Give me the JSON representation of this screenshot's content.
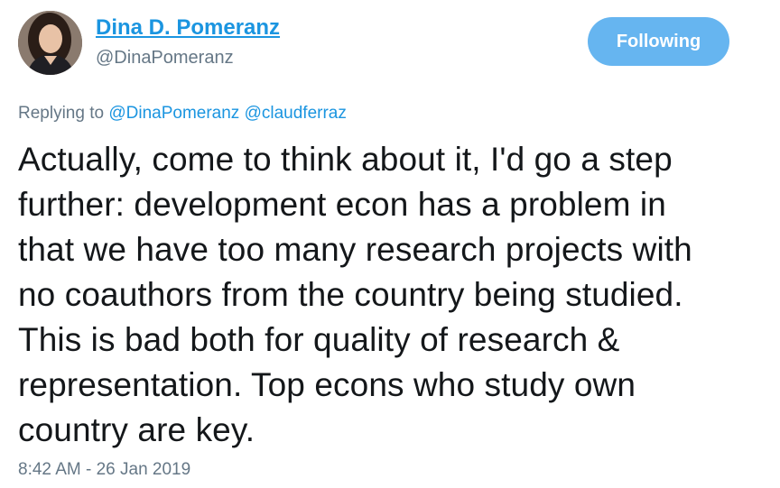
{
  "author": {
    "display_name": "Dina D. Pomeranz",
    "handle": "@DinaPomeranz",
    "avatar_icon": "profile-photo"
  },
  "follow_button": {
    "label": "Following",
    "color": "#66b5f0"
  },
  "reply": {
    "prefix": "Replying to",
    "mentions": [
      "@DinaPomeranz",
      "@claudferraz"
    ]
  },
  "tweet": {
    "lines": [
      "Actually, come to think about it, I'd go a step",
      "further: development econ has a problem in",
      "that we have too many research projects with",
      "no coauthors from the country being studied.",
      "This is bad both for quality of research &",
      "representation. Top econs who study own",
      "country are key."
    ]
  },
  "timestamp": "8:42 AM - 26 Jan 2019",
  "colors": {
    "link": "#1b95e0",
    "secondary": "#657786",
    "text": "#14171a"
  }
}
